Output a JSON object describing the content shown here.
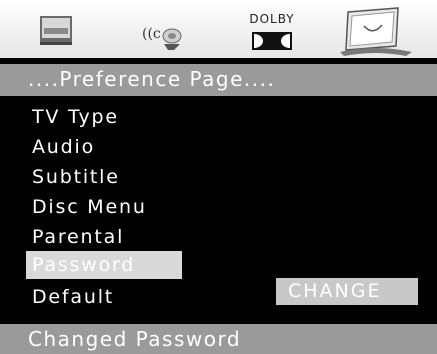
{
  "icons": {
    "general": "tv-screen-icon",
    "audio": "speaker-icon",
    "dolby": "dolby-logo-icon",
    "preference": "smiley-screen-icon"
  },
  "dolby_text": "DOLBY",
  "title": "....Preference Page....",
  "menu": [
    {
      "label": "TV Type"
    },
    {
      "label": "Audio"
    },
    {
      "label": "Subtitle"
    },
    {
      "label": "Disc Menu"
    },
    {
      "label": "Parental"
    },
    {
      "label": "Password"
    },
    {
      "label": "Default"
    }
  ],
  "action": {
    "label": "CHANGE"
  },
  "status": "Changed Password",
  "colors": {
    "background": "#000000",
    "bar": "#9a9a9a",
    "highlight": "#d9d9d9",
    "button": "#c8c8c8"
  }
}
